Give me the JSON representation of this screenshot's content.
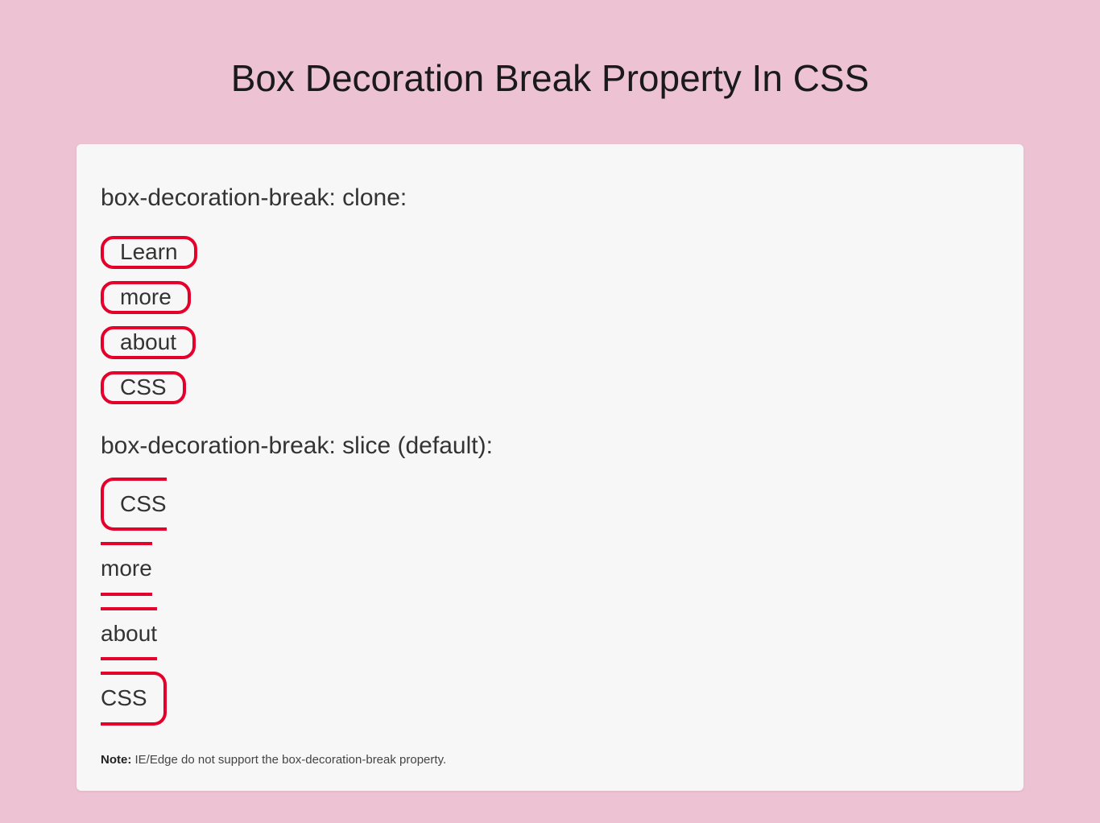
{
  "page": {
    "title": "Box Decoration Break Property In CSS"
  },
  "clone": {
    "label": "box-decoration-break: clone:",
    "words": [
      "Learn",
      "more",
      "about",
      "CSS"
    ]
  },
  "slice": {
    "label": "box-decoration-break: slice (default):",
    "words": [
      "CSS",
      "more",
      "about",
      "CSS"
    ]
  },
  "note": {
    "prefix": "Note:",
    "text": " IE/Edge do not support the box-decoration-break property."
  },
  "colors": {
    "page_bg": "#edc3d4",
    "card_bg": "#f7f7f7",
    "border": "#e5002b"
  }
}
